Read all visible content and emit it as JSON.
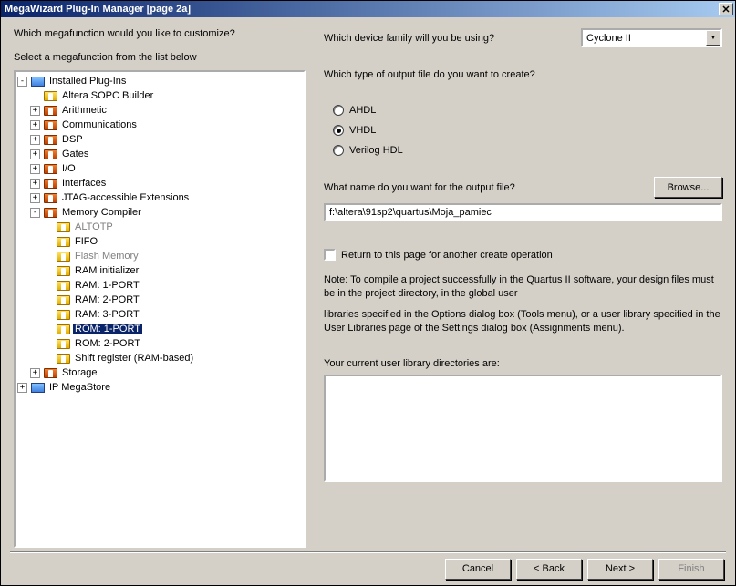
{
  "window": {
    "title": "MegaWizard Plug-In Manager [page 2a]",
    "close": "✕"
  },
  "left": {
    "question": "Which megafunction would you like to customize?",
    "select_label": "Select a megafunction from the list below"
  },
  "tree": [
    {
      "level": 0,
      "exp": "-",
      "iconClass": "icon-toplevel",
      "label": "Installed Plug-Ins"
    },
    {
      "level": 1,
      "exp": "",
      "iconClass": "icon-folder-yellow",
      "label": "Altera SOPC Builder"
    },
    {
      "level": 1,
      "exp": "+",
      "iconClass": "icon-folder-red",
      "label": "Arithmetic"
    },
    {
      "level": 1,
      "exp": "+",
      "iconClass": "icon-folder-red",
      "label": "Communications"
    },
    {
      "level": 1,
      "exp": "+",
      "iconClass": "icon-folder-red",
      "label": "DSP"
    },
    {
      "level": 1,
      "exp": "+",
      "iconClass": "icon-folder-red",
      "label": "Gates"
    },
    {
      "level": 1,
      "exp": "+",
      "iconClass": "icon-folder-red",
      "label": "I/O"
    },
    {
      "level": 1,
      "exp": "+",
      "iconClass": "icon-folder-red",
      "label": "Interfaces"
    },
    {
      "level": 1,
      "exp": "+",
      "iconClass": "icon-folder-red",
      "label": "JTAG-accessible Extensions"
    },
    {
      "level": 1,
      "exp": "-",
      "iconClass": "icon-folder-red",
      "label": "Memory Compiler"
    },
    {
      "level": 2,
      "exp": "",
      "iconClass": "icon-folder-yellow",
      "label": "ALTOTP",
      "disabled": true
    },
    {
      "level": 2,
      "exp": "",
      "iconClass": "icon-folder-yellow",
      "label": "FIFO"
    },
    {
      "level": 2,
      "exp": "",
      "iconClass": "icon-folder-yellow",
      "label": "Flash Memory",
      "disabled": true
    },
    {
      "level": 2,
      "exp": "",
      "iconClass": "icon-folder-yellow",
      "label": "RAM initializer"
    },
    {
      "level": 2,
      "exp": "",
      "iconClass": "icon-folder-yellow",
      "label": "RAM: 1-PORT"
    },
    {
      "level": 2,
      "exp": "",
      "iconClass": "icon-folder-yellow",
      "label": "RAM: 2-PORT"
    },
    {
      "level": 2,
      "exp": "",
      "iconClass": "icon-folder-yellow",
      "label": "RAM: 3-PORT"
    },
    {
      "level": 2,
      "exp": "",
      "iconClass": "icon-folder-yellow",
      "label": "ROM: 1-PORT",
      "selected": true
    },
    {
      "level": 2,
      "exp": "",
      "iconClass": "icon-folder-yellow",
      "label": "ROM: 2-PORT"
    },
    {
      "level": 2,
      "exp": "",
      "iconClass": "icon-folder-yellow",
      "label": "Shift register (RAM-based)"
    },
    {
      "level": 1,
      "exp": "+",
      "iconClass": "icon-folder-red",
      "label": "Storage"
    },
    {
      "level": 0,
      "exp": "+",
      "iconClass": "icon-toplevel",
      "label": "IP MegaStore"
    }
  ],
  "right": {
    "device_question": "Which device family will you be using?",
    "device_value": "Cyclone II",
    "output_type_question": "Which type of output file do you want to create?",
    "radios": {
      "ahdl": "AHDL",
      "vhdl": "VHDL",
      "verilog": "Verilog HDL",
      "selected": "vhdl"
    },
    "filename_question": "What name do you want for the output file?",
    "browse": "Browse...",
    "filename_value": "f:\\altera\\91sp2\\quartus\\Moja_pamiec",
    "return_checkbox": "Return to this page for another create operation",
    "note1": "Note: To compile a project successfully in the Quartus II software, your design files must be in the project directory, in the global user",
    "note2": "libraries specified in the Options dialog box (Tools menu), or a user library specified in the User Libraries page of the Settings dialog box (Assignments menu).",
    "lib_label": "Your current user library directories are:"
  },
  "buttons": {
    "cancel": "Cancel",
    "back": "< Back",
    "next": "Next >",
    "finish": "Finish"
  }
}
